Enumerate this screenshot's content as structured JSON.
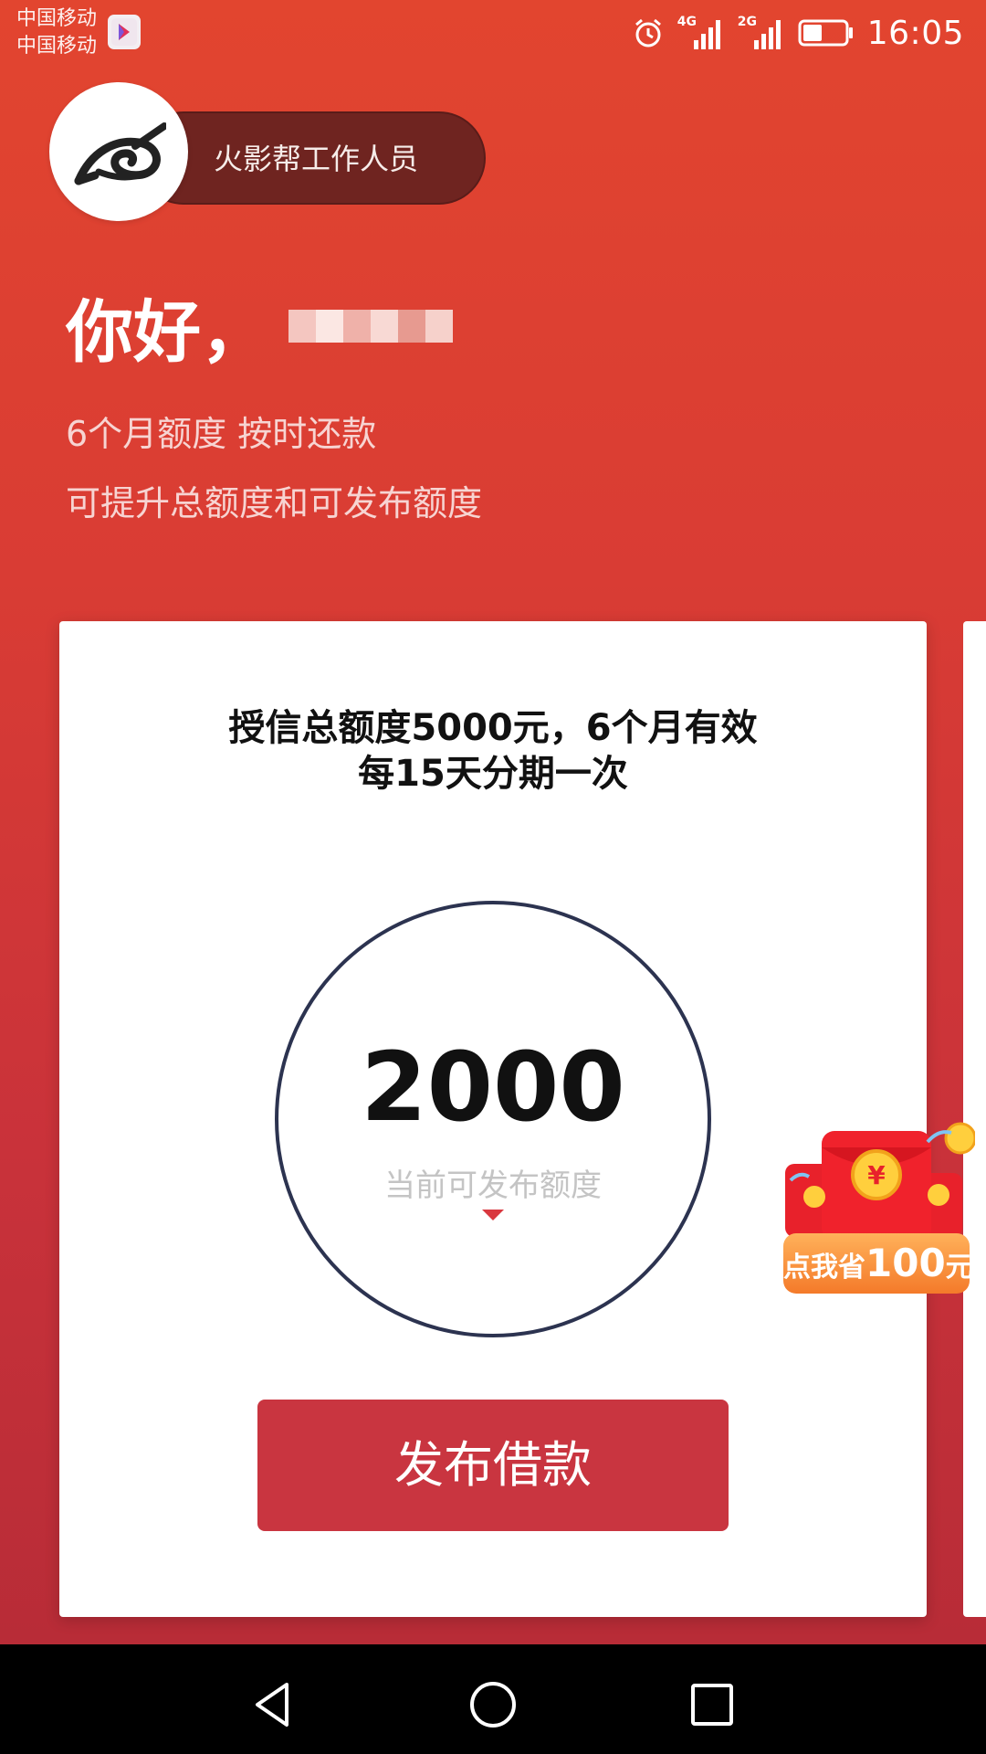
{
  "status_bar": {
    "carrier_1": "中国移动",
    "carrier_2": "中国移动",
    "network_1": "4G",
    "network_2": "2G",
    "time": "16:05",
    "battery_level": 0.45,
    "icons": [
      "alarm-icon",
      "signal-icon",
      "battery-icon"
    ]
  },
  "header": {
    "pill_label": "火影帮工作人员",
    "logo_icon": "leaf-village-logo-icon"
  },
  "greeting": {
    "title": "你好，",
    "subtitle_line1": "6个月额度 按时还款",
    "subtitle_line2": "可提升总额度和可发布额度"
  },
  "card": {
    "title_line1": "授信总额度5000元，6个月有效",
    "title_line2": "每15天分期一次",
    "quota_amount": "2000",
    "quota_label": "当前可发布额度",
    "publish_button": "发布借款"
  },
  "promo": {
    "label_prefix": "点我省",
    "label_amount": "100",
    "label_suffix": "元"
  },
  "colors": {
    "background_top": "#e2452f",
    "background_bottom": "#b82c37",
    "pill": "#6f2420",
    "button": "#c93540",
    "ring": "#2c3350"
  }
}
